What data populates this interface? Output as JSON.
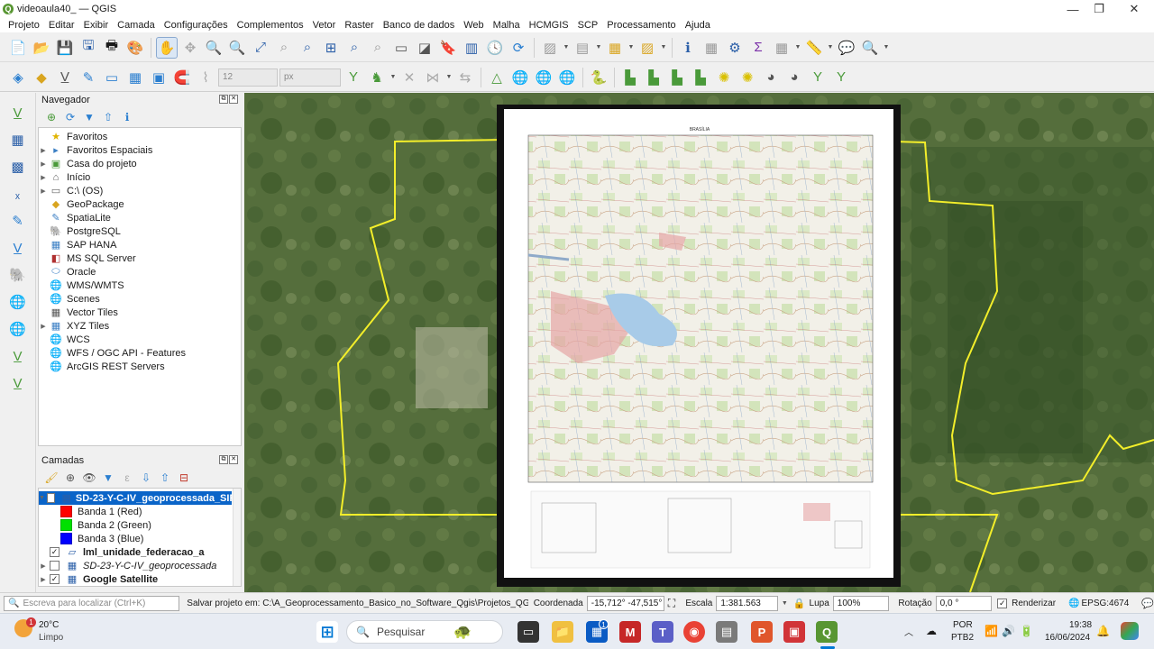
{
  "window": {
    "title": "videoaula40_ — QGIS",
    "logo_letter": "Q",
    "min": "—",
    "max": "❐",
    "close": "✕"
  },
  "menu": [
    "Projeto",
    "Editar",
    "Exibir",
    "Camada",
    "Configurações",
    "Complementos",
    "Vetor",
    "Raster",
    "Banco de dados",
    "Web",
    "Malha",
    "HCMGIS",
    "SCP",
    "Processamento",
    "Ajuda"
  ],
  "toolbar2": {
    "size_value": "12",
    "unit_value": "px"
  },
  "navigator": {
    "title": "Navegador",
    "items": [
      {
        "label": "Favoritos",
        "icon": "star-icon",
        "glyph": "★",
        "color": "#e0b400",
        "arrow": ""
      },
      {
        "label": "Favoritos Espaciais",
        "icon": "spatial-bookmarks-icon",
        "glyph": "▸",
        "color": "#3b7fc4",
        "arrow": "▶"
      },
      {
        "label": "Casa do projeto",
        "icon": "project-home-icon",
        "glyph": "▣",
        "color": "#4a9a3a",
        "arrow": "▶"
      },
      {
        "label": "Início",
        "icon": "home-icon",
        "glyph": "⌂",
        "color": "#555555",
        "arrow": "▶"
      },
      {
        "label": "C:\\ (OS)",
        "icon": "drive-icon",
        "glyph": "▭",
        "color": "#666666",
        "arrow": "▶"
      },
      {
        "label": "GeoPackage",
        "icon": "geopackage-icon",
        "glyph": "◆",
        "color": "#d9a520",
        "arrow": ""
      },
      {
        "label": "SpatiaLite",
        "icon": "spatialite-icon",
        "glyph": "✎",
        "color": "#3b7fc4",
        "arrow": ""
      },
      {
        "label": "PostgreSQL",
        "icon": "postgresql-icon",
        "glyph": "🐘",
        "color": "#336791",
        "arrow": ""
      },
      {
        "label": "SAP HANA",
        "icon": "sap-hana-icon",
        "glyph": "▦",
        "color": "#3b7fc4",
        "arrow": ""
      },
      {
        "label": "MS SQL Server",
        "icon": "mssql-icon",
        "glyph": "◧",
        "color": "#b03030",
        "arrow": ""
      },
      {
        "label": "Oracle",
        "icon": "oracle-icon",
        "glyph": "⬭",
        "color": "#3b7fc4",
        "arrow": ""
      },
      {
        "label": "WMS/WMTS",
        "icon": "wms-icon",
        "glyph": "🌐",
        "color": "#3b7fc4",
        "arrow": ""
      },
      {
        "label": "Scenes",
        "icon": "scenes-icon",
        "glyph": "🌐",
        "color": "#3b7fc4",
        "arrow": ""
      },
      {
        "label": "Vector Tiles",
        "icon": "vector-tiles-icon",
        "glyph": "▦",
        "color": "#555555",
        "arrow": ""
      },
      {
        "label": "XYZ Tiles",
        "icon": "xyz-tiles-icon",
        "glyph": "▦",
        "color": "#3b7fc4",
        "arrow": "▶"
      },
      {
        "label": "WCS",
        "icon": "wcs-icon",
        "glyph": "🌐",
        "color": "#3b7fc4",
        "arrow": ""
      },
      {
        "label": "WFS / OGC API - Features",
        "icon": "wfs-icon",
        "glyph": "🌐",
        "color": "#3b7fc4",
        "arrow": ""
      },
      {
        "label": "ArcGIS REST Servers",
        "icon": "arcgis-icon",
        "glyph": "🌐",
        "color": "#3b7fc4",
        "arrow": ""
      }
    ]
  },
  "layers": {
    "title": "Camadas",
    "items": [
      {
        "label": "SD-23-Y-C-IV_geoprocessada_SIR",
        "kind": "layer",
        "checked": "✓",
        "arrow": "▼",
        "selected": true,
        "italic": false
      },
      {
        "label": "Banda 1 (Red)",
        "kind": "band",
        "color": "#ff0000"
      },
      {
        "label": "Banda 2 (Green)",
        "kind": "band",
        "color": "#00e000"
      },
      {
        "label": "Banda 3 (Blue)",
        "kind": "band",
        "color": "#0000ff"
      },
      {
        "label": "lml_unidade_federacao_a",
        "kind": "layer",
        "checked": "✓",
        "arrow": "",
        "selected": false,
        "italic": false,
        "bold": true
      },
      {
        "label": "SD-23-Y-C-IV_geoprocessada",
        "kind": "layer",
        "checked": "",
        "arrow": "▶",
        "selected": false,
        "italic": true
      },
      {
        "label": "Google Satellite",
        "kind": "layer",
        "checked": "✓",
        "arrow": "▶",
        "selected": false,
        "italic": false,
        "bold": true
      }
    ]
  },
  "map": {
    "sheet_title": "BRASÍLIA",
    "boundary_color": "#f3ee2a"
  },
  "status": {
    "locator_placeholder": "Escreva para localizar (Ctrl+K)",
    "message": "Salvar projeto em: C:\\A_Geoprocessamento_Basico_no_Software_Qgis\\Projetos_QGIS\\videoaula",
    "coord_label": "Coordenada",
    "coord_value": "-15,712°  -47,515°",
    "scale_label": "Escala",
    "scale_value": "1:381.563",
    "zoom_label": "Lupa",
    "zoom_value": "100%",
    "rotation_label": "Rotação",
    "rotation_value": "0,0 °",
    "render_label": "Renderizar",
    "crs": "EPSG:4674"
  },
  "taskbar": {
    "weather_temp": "20°C",
    "weather_desc": "Limpo",
    "search_placeholder": "Pesquisar",
    "lang1": "POR",
    "lang2": "PTB2",
    "time": "19:38",
    "date": "16/06/2024",
    "weather_badge": "1",
    "store_badge": "1"
  }
}
